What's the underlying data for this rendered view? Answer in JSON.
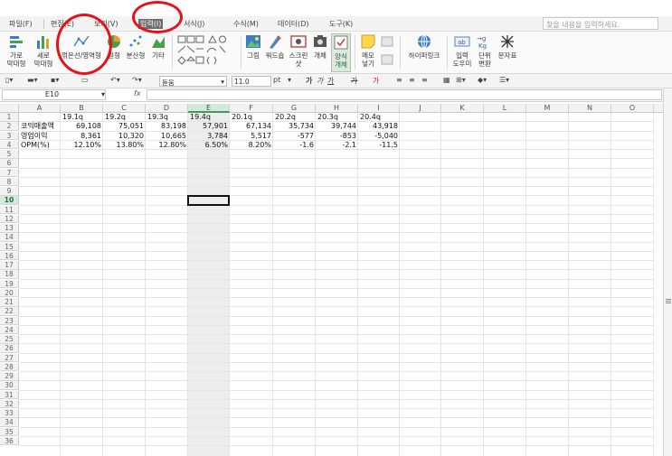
{
  "menu": {
    "items": [
      "파일(F)",
      "편집(E)",
      "보기(V)",
      "입력(I)",
      "서식(J)",
      "수식(M)",
      "데이터(D)",
      "도구(K)"
    ],
    "search_placeholder": "찾을 내용을 입력하세요."
  },
  "ribbon": {
    "buttons": [
      {
        "label": "가로\n막대형",
        "icon": "horizontal-bar-chart-icon"
      },
      {
        "label": "세로\n막대형",
        "icon": "vertical-bar-chart-icon"
      },
      {
        "label": "꺾은선/영역형",
        "icon": "line-area-chart-icon"
      },
      {
        "label": "원형",
        "icon": "pie-chart-icon"
      },
      {
        "label": "분산형",
        "icon": "scatter-chart-icon"
      },
      {
        "label": "기타",
        "icon": "other-chart-icon"
      },
      {
        "label": "그림",
        "icon": "picture-icon"
      },
      {
        "label": "워드숍",
        "icon": "wordart-icon"
      },
      {
        "label": "스크린\n샷",
        "icon": "screenshot-icon"
      },
      {
        "label": "개체",
        "icon": "object-icon"
      },
      {
        "label": "양식\n개체",
        "icon": "form-object-icon"
      },
      {
        "label": "메모\n넣기",
        "icon": "memo-icon"
      },
      {
        "label": "하이퍼링크",
        "icon": "hyperlink-icon"
      },
      {
        "label": "입력\n도우미",
        "icon": "input-helper-icon"
      },
      {
        "label": "단위\n변환",
        "icon": "unit-convert-icon"
      },
      {
        "label": "문자표",
        "icon": "symbol-icon"
      }
    ]
  },
  "toolbar": {
    "font_name": "돋움",
    "font_size": "11.0",
    "font_unit": "pt",
    "bold": "가",
    "italic": "가",
    "underline": "가",
    "strike": "가",
    "font_color": "가"
  },
  "formula_bar": {
    "cell_ref": "E10",
    "fx": "fx",
    "value": ""
  },
  "sheet": {
    "columns": [
      "A",
      "B",
      "C",
      "D",
      "E",
      "F",
      "G",
      "H",
      "I",
      "J",
      "K",
      "L",
      "M",
      "N",
      "O"
    ],
    "selected_column": "E",
    "selected_row": "10",
    "rows": [
      "1",
      "2",
      "3",
      "4",
      "5",
      "6",
      "7",
      "8",
      "9",
      "10",
      "11",
      "12",
      "13",
      "14",
      "15",
      "16",
      "17",
      "18",
      "19",
      "20",
      "21",
      "22",
      "23",
      "24",
      "25",
      "26",
      "27",
      "28",
      "29",
      "30",
      "31",
      "32",
      "33",
      "34",
      "35",
      "36"
    ],
    "data": [
      [
        "",
        "19.1q",
        "19.2q",
        "19.3q",
        "19.4q",
        "20.1q",
        "20.2q",
        "20.3q",
        "20.4q"
      ],
      [
        "코믹매출액",
        "69,108",
        "75,051",
        "83,198",
        "57,901",
        "67,134",
        "35,734",
        "39,744",
        "43,918"
      ],
      [
        "영업이익",
        "8,361",
        "10,320",
        "10,665",
        "3,784",
        "5,517",
        "-577",
        "-853",
        "-5,040"
      ],
      [
        "OPM(%)",
        "12.10%",
        "13.80%",
        "12.80%",
        "6.50%",
        "8.20%",
        "-1.6",
        "-2.1",
        "-11.5"
      ]
    ]
  },
  "colors": {
    "selected_header": "#d3e9dc",
    "annotation": "#e8111a"
  }
}
